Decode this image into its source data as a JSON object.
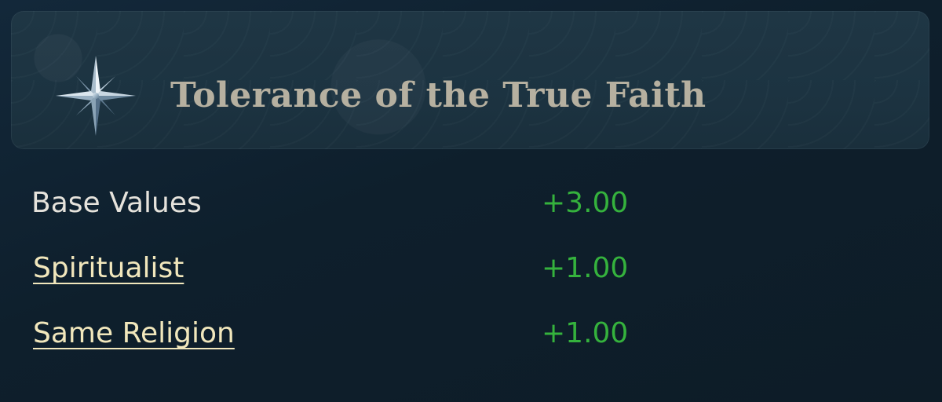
{
  "header": {
    "title": "Tolerance of the True Faith",
    "icon": "compass-star-icon"
  },
  "modifiers": [
    {
      "label": "Base Values",
      "value": "+3.00",
      "is_link": false
    },
    {
      "label": "Spiritualist",
      "value": "+1.00",
      "is_link": true
    },
    {
      "label": "Same Religion",
      "value": "+1.00",
      "is_link": true
    }
  ],
  "colors": {
    "positive_value": "#35b23d",
    "link_text": "#f1e7bc",
    "title_text": "#b6b0a0"
  }
}
